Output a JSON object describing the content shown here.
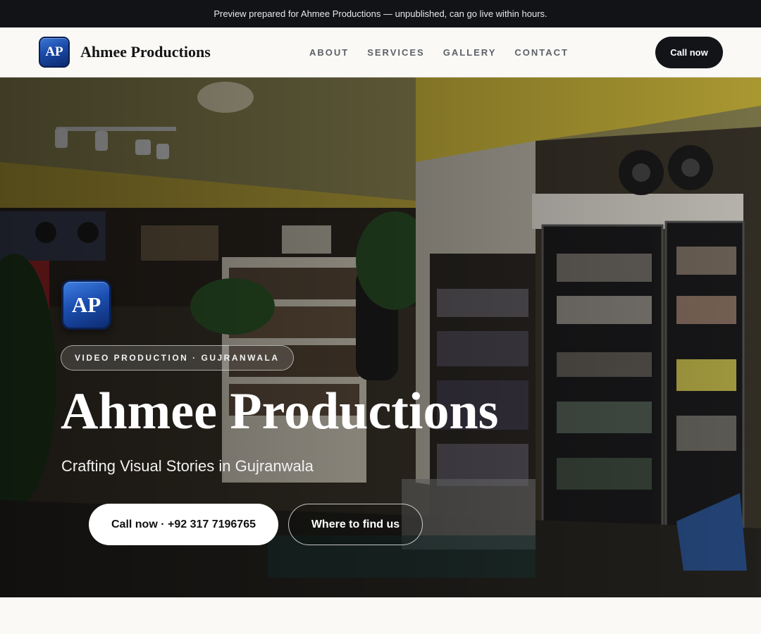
{
  "announcement": "Preview prepared for Ahmee Productions — unpublished, can go live within hours.",
  "brand": {
    "logo_text": "AP",
    "name": "Ahmee Productions"
  },
  "nav": {
    "items": [
      "ABOUT",
      "SERVICES",
      "GALLERY",
      "CONTACT"
    ]
  },
  "header_cta": "Call now",
  "hero": {
    "logo_text": "AP",
    "tag": "VIDEO PRODUCTION · GUJRANWALA",
    "title": "Ahmee Productions",
    "subtitle": "Crafting Visual Stories in Gujranwala",
    "primary_button": "Call now · +92 317 7196765",
    "secondary_button": "Where to find us"
  },
  "colors": {
    "topbar": "#111317",
    "header_bg": "#faf9f6",
    "accent_dark": "#121418",
    "logo_blue": "#1a4aa8"
  }
}
